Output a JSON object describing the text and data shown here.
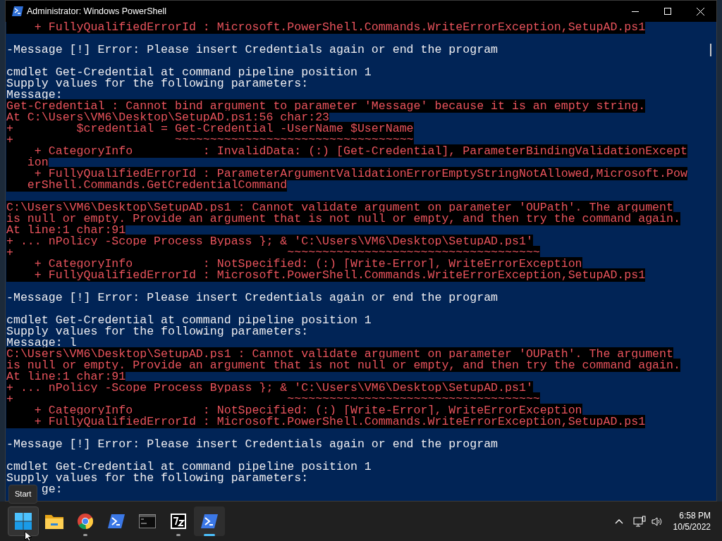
{
  "window": {
    "title": "Administrator: Windows PowerShell"
  },
  "console": {
    "lines": [
      {
        "kind": "error",
        "text": "    + FullyQualifiedErrorId : Microsoft.PowerShell.Commands.WriteErrorException,SetupAD.ps1"
      },
      {
        "kind": "blank"
      },
      {
        "kind": "output",
        "text": "-Message [!] Error: Please insert Credentials again or end the program"
      },
      {
        "kind": "blank"
      },
      {
        "kind": "output",
        "text": "cmdlet Get-Credential at command pipeline position 1"
      },
      {
        "kind": "output",
        "text": "Supply values for the following parameters:"
      },
      {
        "kind": "output",
        "text": "Message:"
      },
      {
        "kind": "error",
        "text": "Get-Credential : Cannot bind argument to parameter 'Message' because it is an empty string."
      },
      {
        "kind": "error",
        "text": "At C:\\Users\\VM6\\Desktop\\SetupAD.ps1:56 char:23"
      },
      {
        "kind": "error",
        "text": "+         $credential = Get-Credential -UserName $UserName"
      },
      {
        "kind": "error",
        "text": "+                       ~~~~~~~~~~~~~~~~~~~~~~~~~~~~~~~~~~"
      },
      {
        "kind": "error",
        "text": "    + CategoryInfo          : InvalidData: (:) [Get-Credential], ParameterBindingValidationExcept"
      },
      {
        "kind": "error",
        "text": "   ion"
      },
      {
        "kind": "error",
        "text": "    + FullyQualifiedErrorId : ParameterArgumentValidationErrorEmptyStringNotAllowed,Microsoft.Pow"
      },
      {
        "kind": "error",
        "text": "   erShell.Commands.GetCredentialCommand"
      },
      {
        "kind": "blank"
      },
      {
        "kind": "error",
        "text": "C:\\Users\\VM6\\Desktop\\SetupAD.ps1 : Cannot validate argument on parameter 'OUPath'. The argument"
      },
      {
        "kind": "error",
        "text": "is null or empty. Provide an argument that is not null or empty, and then try the command again."
      },
      {
        "kind": "error",
        "text": "At line:1 char:91"
      },
      {
        "kind": "error",
        "text": "+ ... nPolicy -Scope Process Bypass }; & 'C:\\Users\\VM6\\Desktop\\SetupAD.ps1'"
      },
      {
        "kind": "error",
        "text": "+                                       ~~~~~~~~~~~~~~~~~~~~~~~~~~~~~~~~~~~~"
      },
      {
        "kind": "error",
        "text": "    + CategoryInfo          : NotSpecified: (:) [Write-Error], WriteErrorException"
      },
      {
        "kind": "error",
        "text": "    + FullyQualifiedErrorId : Microsoft.PowerShell.Commands.WriteErrorException,SetupAD.ps1"
      },
      {
        "kind": "blank"
      },
      {
        "kind": "output",
        "text": "-Message [!] Error: Please insert Credentials again or end the program"
      },
      {
        "kind": "blank"
      },
      {
        "kind": "output",
        "text": "cmdlet Get-Credential at command pipeline position 1"
      },
      {
        "kind": "output",
        "text": "Supply values for the following parameters:"
      },
      {
        "kind": "output",
        "text": "Message: l"
      },
      {
        "kind": "error",
        "text": "C:\\Users\\VM6\\Desktop\\SetupAD.ps1 : Cannot validate argument on parameter 'OUPath'. The argument"
      },
      {
        "kind": "error",
        "text": "is null or empty. Provide an argument that is not null or empty, and then try the command again."
      },
      {
        "kind": "error",
        "text": "At line:1 char:91"
      },
      {
        "kind": "error",
        "text": "+ ... nPolicy -Scope Process Bypass }; & 'C:\\Users\\VM6\\Desktop\\SetupAD.ps1'"
      },
      {
        "kind": "error",
        "text": "+                                       ~~~~~~~~~~~~~~~~~~~~~~~~~~~~~~~~~~~~"
      },
      {
        "kind": "error",
        "text": "    + CategoryInfo          : NotSpecified: (:) [Write-Error], WriteErrorException"
      },
      {
        "kind": "error",
        "text": "    + FullyQualifiedErrorId : Microsoft.PowerShell.Commands.WriteErrorException,SetupAD.ps1"
      },
      {
        "kind": "blank"
      },
      {
        "kind": "output",
        "text": "-Message [!] Error: Please insert Credentials again or end the program"
      },
      {
        "kind": "blank"
      },
      {
        "kind": "output",
        "text": "cmdlet Get-Credential at command pipeline position 1"
      },
      {
        "kind": "output",
        "text": "Supply values for the following parameters:"
      },
      {
        "kind": "output",
        "text": "     ge:"
      }
    ]
  },
  "tooltip": "Start",
  "taskbar": {
    "items": [
      {
        "kind": "start",
        "running": false,
        "selected": false,
        "hovered": true
      },
      {
        "kind": "folder",
        "running": false,
        "selected": false,
        "hovered": false
      },
      {
        "kind": "browser",
        "running": true,
        "selected": false,
        "hovered": false
      },
      {
        "kind": "powershell",
        "running": false,
        "selected": false,
        "hovered": false
      },
      {
        "kind": "terminal",
        "running": false,
        "selected": false,
        "hovered": false
      },
      {
        "kind": "archiver",
        "running": true,
        "selected": false,
        "hovered": false
      },
      {
        "kind": "powershell",
        "running": true,
        "selected": true,
        "hovered": false
      }
    ],
    "clock": {
      "time": "6:58 PM",
      "date": "10/5/2022"
    }
  }
}
